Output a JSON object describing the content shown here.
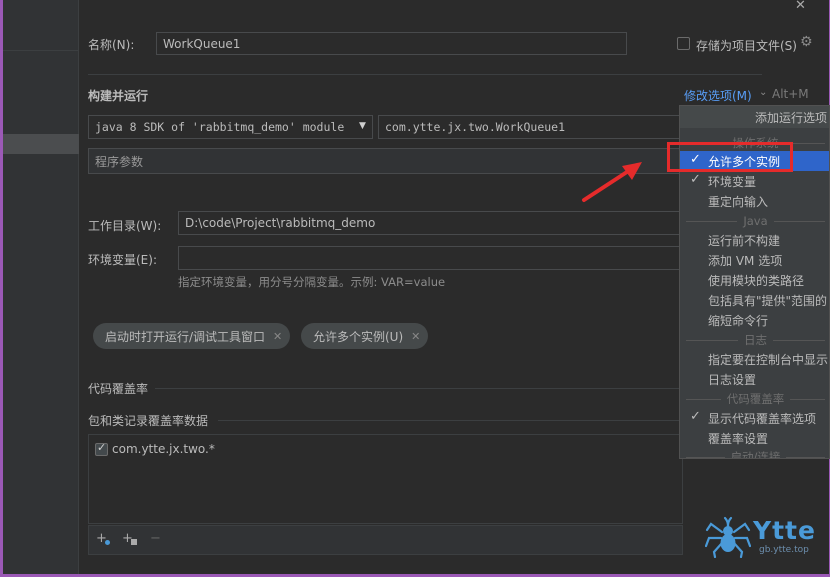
{
  "name_label": "名称(N):",
  "name_value": "WorkQueue1",
  "store_label": "存储为项目文件(S)",
  "build_section": "构建并运行",
  "modify_options": "修改选项(M)",
  "modify_shortcut": "Alt+M",
  "sdk_value": "java 8 SDK of 'rabbitmq_demo' module",
  "main_class": "com.ytte.jx.two.WorkQueue1",
  "program_args_placeholder": "程序参数",
  "workdir_label": "工作目录(W):",
  "workdir_value": "D:\\code\\Project\\rabbitmq_demo",
  "env_label": "环境变量(E):",
  "env_hint": "指定环境变量，用分号分隔变量。示例: VAR=value",
  "chips": [
    "启动时打开运行/调试工具窗口",
    "允许多个实例(U)"
  ],
  "coverage_section": "代码覆盖率",
  "coverage_pkg_label": "包和类记录覆盖率数据",
  "coverage_item": "com.ytte.jx.two.*",
  "popup": {
    "header": "添加运行选项",
    "group_os": "操作系统",
    "item_allow_multiple": "允许多个实例",
    "item_env": "环境变量",
    "item_redirect": "重定向输入",
    "group_java": "Java",
    "item_no_build": "运行前不构建",
    "item_vm": "添加 VM 选项",
    "item_module_cp": "使用模块的类路径",
    "item_provided": "包括具有\"提供\"范围的",
    "item_shorten": "缩短命令行",
    "group_log": "日志",
    "item_console_log": "指定要在控制台中显示的",
    "item_log_settings": "日志设置",
    "group_coverage": "代码覆盖率",
    "item_show_coverage": "显示代码覆盖率选项",
    "item_coverage_settings": "覆盖率设置",
    "group_startup": "启动/连接"
  },
  "watermark_brand": "Ytte",
  "watermark_sub": "gb.ytte.top",
  "colors": {
    "accent_blue": "#2f65ca",
    "link_blue": "#589df6",
    "annotation_red": "#e52b2b",
    "brand_blue": "#4a9ad8"
  }
}
